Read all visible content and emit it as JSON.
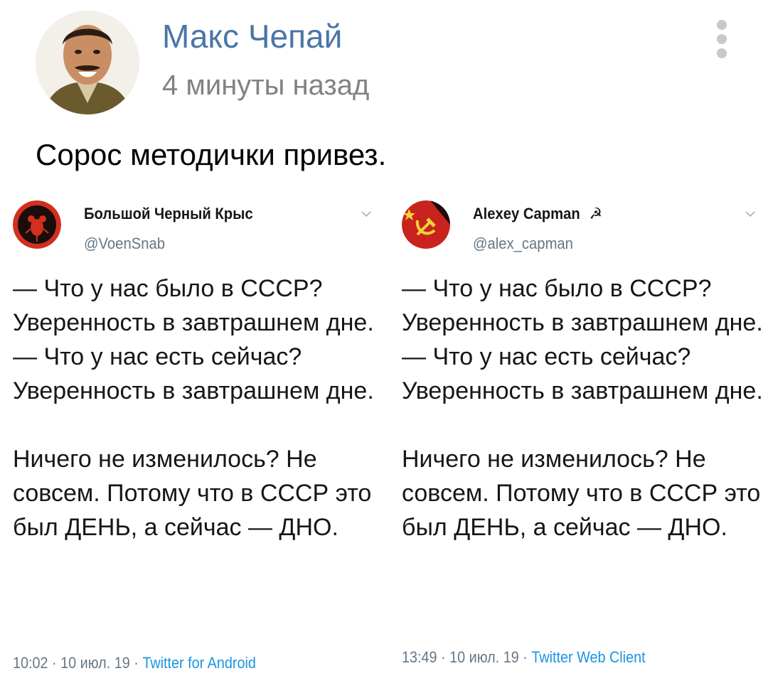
{
  "post": {
    "author_name": "Макс Чепай",
    "time": "4 минуты назад",
    "text": "Сорос методички привез.",
    "icons": {
      "avatar": "author-avatar-portrait",
      "more": "vertical-dots-icon"
    }
  },
  "tweets": [
    {
      "name": "Большой Черный Крыс",
      "handle": "@VoenSnab",
      "avatar_icon": "rat-logo-avatar",
      "body": "— Что у нас было в СССР? Уверенность в завтрашнем дне.\n— Что у нас есть сейчас? Уверенность в завтрашнем дне.\n\nНичего не изменилось? Не совсем. Потому что в СССР это был ДЕНЬ, а сейчас — ДНО.",
      "time": "10:02 · 10 июл. 19 · ",
      "client": "Twitter for Android"
    },
    {
      "name": "Alexey Capman",
      "name_emoji": "☭",
      "handle": "@alex_capman",
      "avatar_icon": "hammer-sickle-avatar",
      "body": "— Что у нас было в СССР? Уверенность в завтрашнем дне.\n— Что у нас есть сейчас? Уверенность в завтрашнем дне.\n\nНичего не изменилось? Не совсем. Потому что в СССР это был ДЕНЬ, а сейчас — ДНО.",
      "time": "13:49 · 10 июл. 19 · ",
      "client": "Twitter Web Client"
    }
  ],
  "colors": {
    "author_link": "#4a76a8",
    "muted": "#828282",
    "twitter_blue": "#1b95e0",
    "twitter_gray": "#657786"
  }
}
